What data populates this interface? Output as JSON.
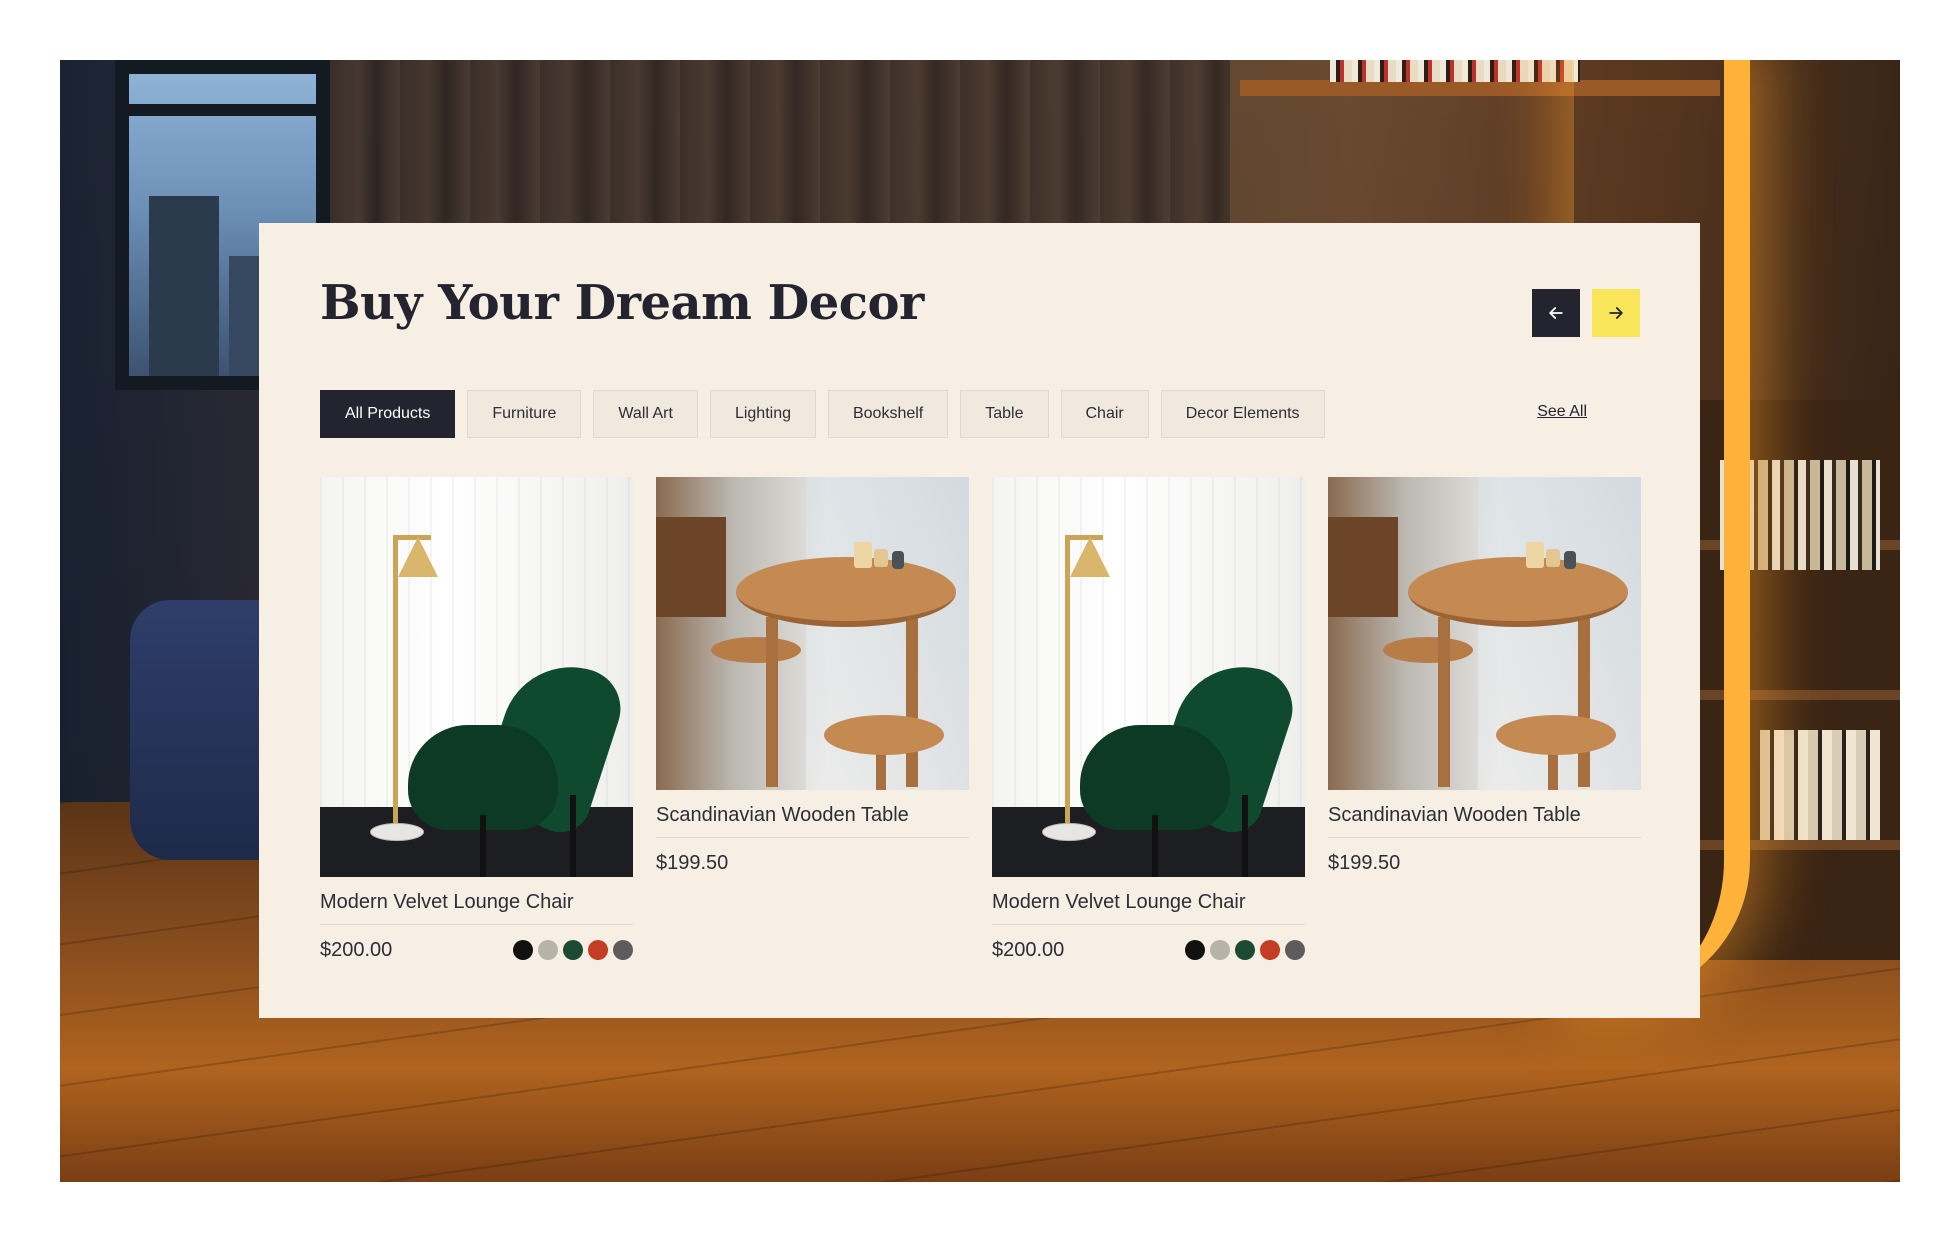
{
  "header": {
    "title": "Buy Your Dream Decor",
    "prev_icon": "arrow-left-icon",
    "next_icon": "arrow-right-icon"
  },
  "filters": {
    "items": [
      "All Products",
      "Furniture",
      "Wall Art",
      "Lighting",
      "Bookshelf",
      "Table",
      "Chair",
      "Decor Elements"
    ],
    "active": "All Products",
    "see_all": "See All"
  },
  "products": [
    {
      "name": "Modern Velvet Lounge Chair",
      "price": "$200.00",
      "swatches": [
        "#111111",
        "#b8b3a8",
        "#1d4a34",
        "#c43d25",
        "#5c5c5c"
      ]
    },
    {
      "name": "Scandinavian Wooden Table",
      "price": "$199.50"
    },
    {
      "name": "Modern Velvet Lounge Chair",
      "price": "$200.00",
      "swatches": [
        "#111111",
        "#b8b3a8",
        "#1d4a34",
        "#c43d25",
        "#5c5c5c"
      ]
    },
    {
      "name": "Scandinavian Wooden Table",
      "price": "$199.50"
    }
  ],
  "colors": {
    "card_bg": "#f8efe4",
    "primary_dark": "#23242f",
    "accent_yellow": "#f8e55a"
  }
}
